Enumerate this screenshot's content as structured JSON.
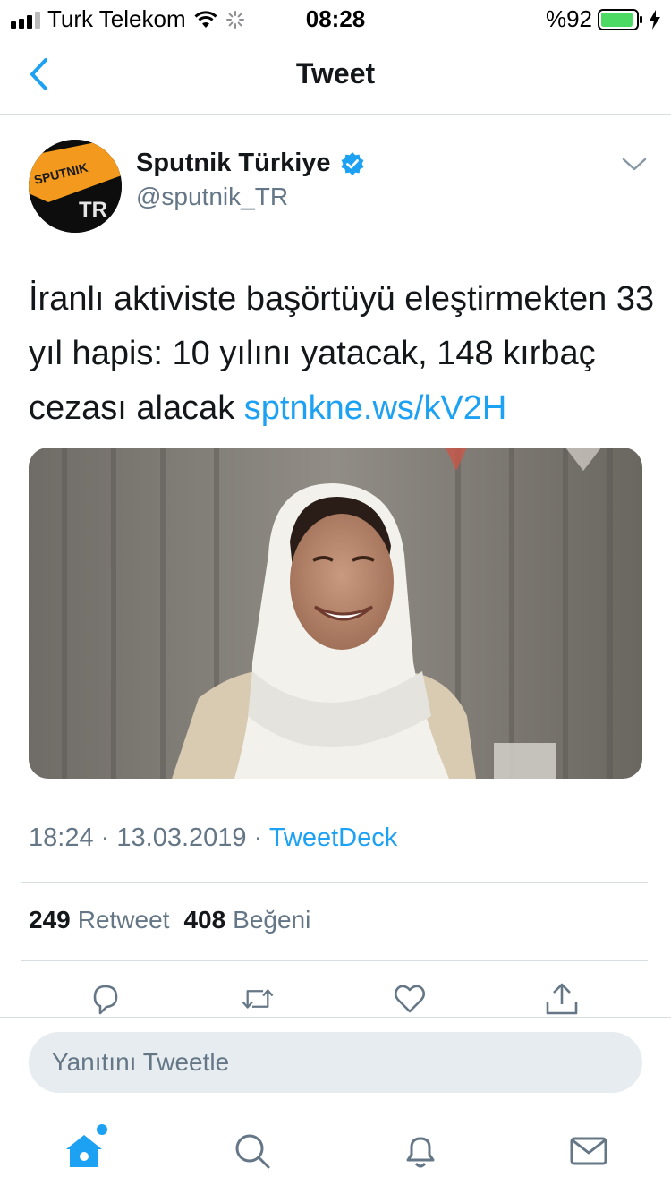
{
  "status_bar": {
    "carrier": "Turk Telekom",
    "time": "08:28",
    "battery_text": "%92",
    "battery_level": 0.92,
    "battery_color": "#4cd964"
  },
  "nav": {
    "title": "Tweet",
    "back_icon": "chevron-left-icon"
  },
  "tweet": {
    "author_name": "Sputnik Türkiye",
    "author_handle": "@sputnik_TR",
    "verified": true,
    "avatar_text_top": "SPUTNIK",
    "avatar_text_bottom": "TR",
    "text": "İranlı aktiviste başörtüyü eleştirmekten 33 yıl hapis: 10 yılını yatacak, 148 kırbaç cezası alacak",
    "link": "sptnkne.ws/kV2H",
    "time": "18:24",
    "date": "13.03.2019",
    "source": "TweetDeck",
    "separator": "·",
    "retweets_count": "249",
    "retweets_label": "Retweet",
    "likes_count": "408",
    "likes_label": "Beğeni"
  },
  "actions": [
    "reply-icon",
    "retweet-icon",
    "like-icon",
    "share-icon"
  ],
  "reply": {
    "placeholder": "Yanıtını Tweetle"
  },
  "tab_bar": [
    "home-icon",
    "search-icon",
    "notifications-icon",
    "messages-icon"
  ],
  "colors": {
    "accent": "#1da1f2",
    "text": "#14171a",
    "secondary": "#657786",
    "divider": "#d8dde1",
    "avatar_orange": "#f39a1e"
  }
}
